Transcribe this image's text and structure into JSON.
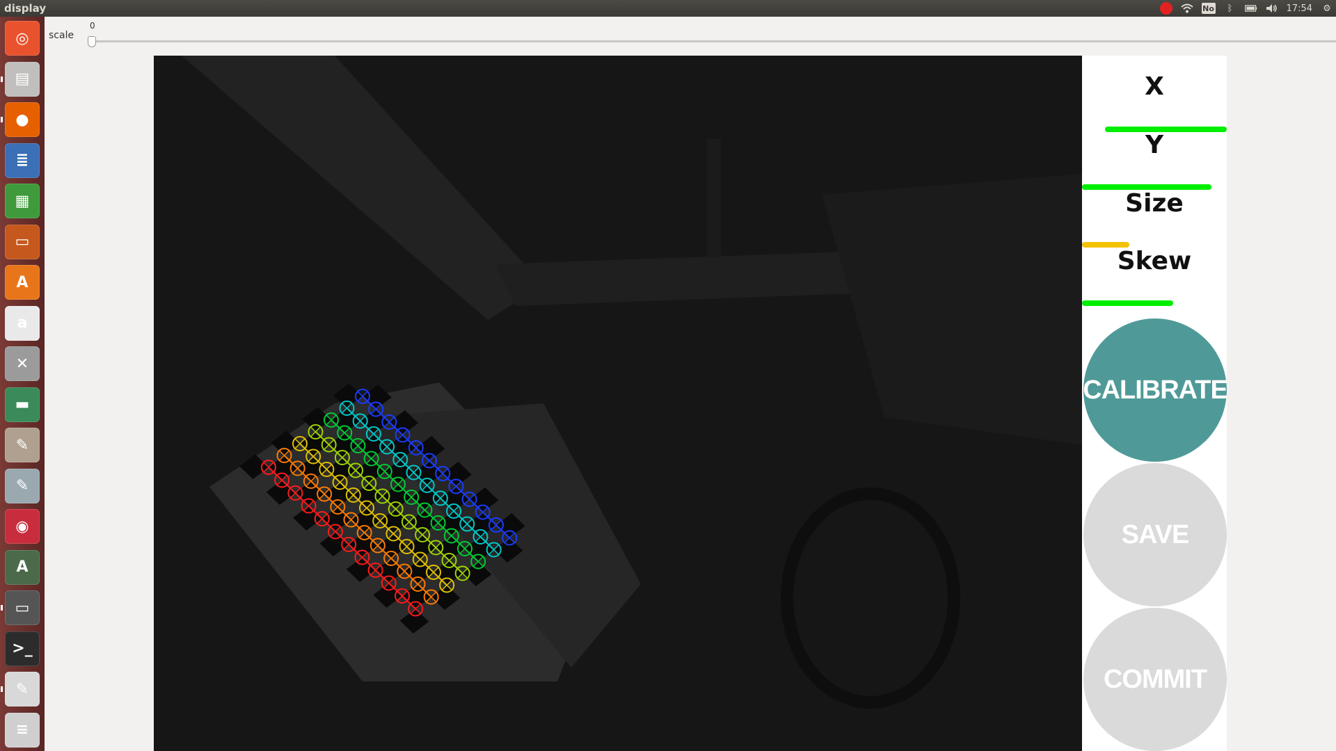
{
  "topbar": {
    "title": "display",
    "clock": "17:54",
    "keyboard": "No",
    "colors": {
      "record": "#e22222"
    }
  },
  "launcher": {
    "items": [
      {
        "name": "ubuntu-dash-icon",
        "glyph": "◎",
        "color": "#e8522d"
      },
      {
        "name": "files-icon",
        "glyph": "▤",
        "color": "#c0bfbd"
      },
      {
        "name": "firefox-icon",
        "glyph": "●",
        "color": "#e66000"
      },
      {
        "name": "writer-icon",
        "glyph": "≣",
        "color": "#3b6fb6"
      },
      {
        "name": "calc-icon",
        "glyph": "▦",
        "color": "#3e9a3a"
      },
      {
        "name": "impress-icon",
        "glyph": "▭",
        "color": "#c5581c"
      },
      {
        "name": "software-center-icon",
        "glyph": "A",
        "color": "#e8751a"
      },
      {
        "name": "amazon-icon",
        "glyph": "a",
        "color": "#e9e9e9"
      },
      {
        "name": "settings-icon",
        "glyph": "✕",
        "color": "#9b9b9b"
      },
      {
        "name": "hardware-icon",
        "glyph": "▬",
        "color": "#3a8a5a"
      },
      {
        "name": "paint-brush-icon",
        "glyph": "✎",
        "color": "#b0a090"
      },
      {
        "name": "paint-tube-icon",
        "glyph": "✎",
        "color": "#9aa8b0"
      },
      {
        "name": "app-red-icon",
        "glyph": "◉",
        "color": "#c82d3d"
      },
      {
        "name": "updater-icon",
        "glyph": "A",
        "color": "#4a6a4a"
      },
      {
        "name": "display-icon",
        "glyph": "▭",
        "color": "#555"
      },
      {
        "name": "terminal-icon",
        "glyph": ">_",
        "color": "#2c2c2c"
      },
      {
        "name": "text-editor-icon",
        "glyph": "✎",
        "color": "#d8d8d8"
      },
      {
        "name": "stack-icon",
        "glyph": "≡",
        "color": "#cfcfcf"
      }
    ]
  },
  "toolbar": {
    "scale_label": "scale",
    "scale_value": "0",
    "scale_level": 0
  },
  "side": {
    "metrics": [
      {
        "label": "X",
        "level": 0.92,
        "color": "#00ee00"
      },
      {
        "label": "Y",
        "level": 0.98,
        "color": "#00ee00"
      },
      {
        "label": "Size",
        "level": 0.36,
        "color": "#f2c200"
      },
      {
        "label": "Skew",
        "level": 0.69,
        "color": "#00ee00"
      }
    ],
    "calibrate_label": "CALIBRATE",
    "save_label": "SAVE",
    "commit_label": "COMMIT",
    "colors": {
      "calibrate": "#4f9a98",
      "disabled": "#dadada"
    }
  }
}
